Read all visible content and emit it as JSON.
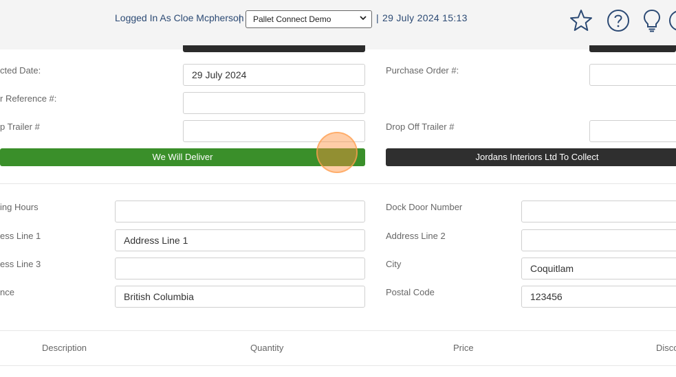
{
  "header": {
    "user_text": "Logged In As Cloe Mcpherson",
    "separator": "|",
    "account_selected": "Pallet Connect Demo",
    "datetime": "29 July 2024 15:13",
    "icons": [
      "star-icon",
      "help-icon",
      "lightbulb-icon",
      "circle-icon"
    ]
  },
  "form": {
    "expected_date_label": "cted Date:",
    "expected_date_value": "29 July 2024",
    "customer_reference_label": "r Reference #:",
    "customer_reference_value": "",
    "pickup_trailer_label": "p Trailer #",
    "pickup_trailer_value": "",
    "purchase_order_label": "Purchase Order #:",
    "purchase_order_value": "",
    "dropoff_trailer_label": "Drop Off Trailer #",
    "dropoff_trailer_value": "",
    "deliver_button": "We Will Deliver",
    "collect_button": "Jordans Interiors Ltd To Collect"
  },
  "address": {
    "opening_hours_label": "ing Hours",
    "opening_hours_value": "",
    "dock_door_label": "Dock Door Number",
    "dock_door_value": "",
    "address1_label": "ess Line 1",
    "address1_value": "Address Line 1",
    "address2_label": "Address Line 2",
    "address2_value": "",
    "address3_label": "ess Line 3",
    "address3_value": "",
    "city_label": "City",
    "city_value": "Coquitlam",
    "province_label": "nce",
    "province_value": "British Columbia",
    "postal_code_label": "Postal Code",
    "postal_code_value": "123456"
  },
  "table": {
    "columns": [
      "Description",
      "Quantity",
      "Price",
      "Disco"
    ]
  }
}
